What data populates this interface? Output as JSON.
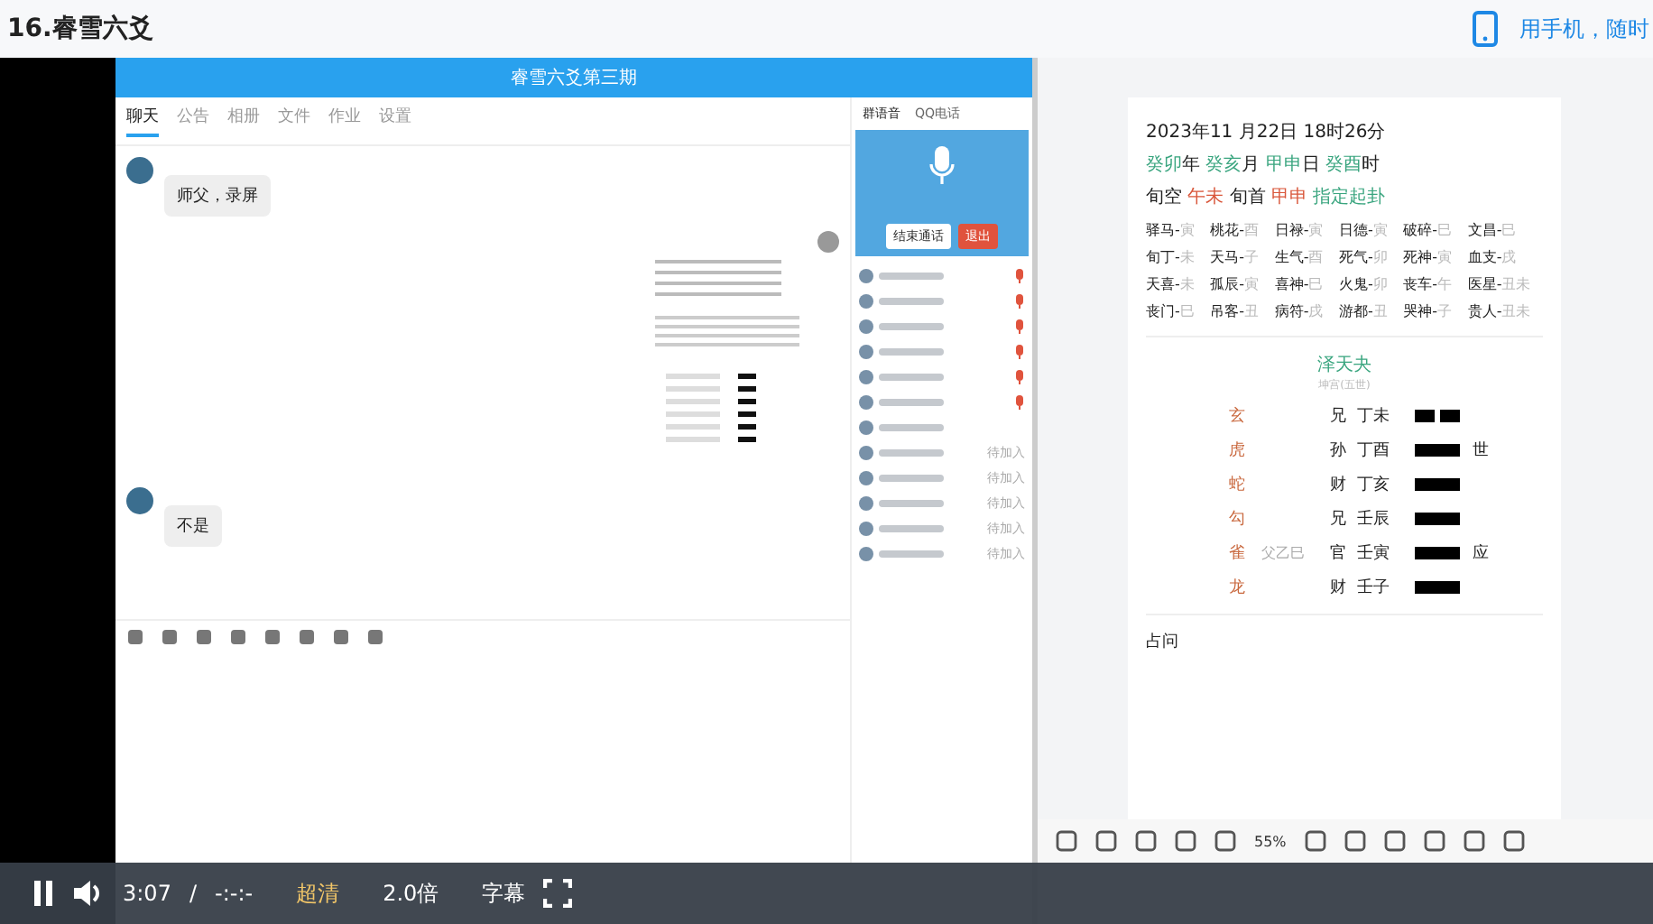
{
  "page": {
    "title": "16.睿雪六爻",
    "mobile_link": "用手机，随时"
  },
  "chat_window": {
    "title": "睿雪六爻第三期",
    "tabs": [
      {
        "label": "聊天",
        "selected": true
      },
      {
        "label": "公告",
        "selected": false
      },
      {
        "label": "相册",
        "selected": false
      },
      {
        "label": "文件",
        "selected": false
      },
      {
        "label": "作业",
        "selected": false
      },
      {
        "label": "设置",
        "selected": false
      }
    ],
    "messages": [
      {
        "kind": "text",
        "text": "师父，录屏"
      },
      {
        "kind": "image"
      },
      {
        "kind": "text",
        "text": "不是"
      }
    ],
    "voice_panel": {
      "tabs": [
        {
          "label": "群语音",
          "selected": true
        },
        {
          "label": "QQ电话",
          "selected": false
        }
      ],
      "end_button": "结束通话",
      "exit_button": "退出",
      "members": [
        {
          "kind": "muted"
        },
        {
          "kind": "muted"
        },
        {
          "kind": "muted"
        },
        {
          "kind": "muted"
        },
        {
          "kind": "muted"
        },
        {
          "kind": "muted"
        },
        {
          "kind": "idle"
        },
        {
          "kind": "pending",
          "label": "待加入"
        },
        {
          "kind": "pending",
          "label": "待加入"
        },
        {
          "kind": "pending",
          "label": "待加入"
        },
        {
          "kind": "pending",
          "label": "待加入"
        },
        {
          "kind": "pending",
          "label": "待加入"
        }
      ]
    }
  },
  "divination": {
    "date": "2023年11 月22日 18时26分",
    "ganzhi": [
      {
        "text": "癸卯",
        "color": "#3aa57f"
      },
      {
        "text": "年 ",
        "color": "#222222"
      },
      {
        "text": "癸亥",
        "color": "#3aa57f"
      },
      {
        "text": "月 ",
        "color": "#222222"
      },
      {
        "text": "甲申",
        "color": "#3aa57f"
      },
      {
        "text": "日 ",
        "color": "#222222"
      },
      {
        "text": "癸酉",
        "color": "#3aa57f"
      },
      {
        "text": "时",
        "color": "#222222"
      }
    ],
    "void": [
      {
        "text": "旬空 ",
        "color": "#222222"
      },
      {
        "text": "午未",
        "color": "#d9573b"
      },
      {
        "text": " 旬首 ",
        "color": "#222222"
      },
      {
        "text": "甲申",
        "color": "#d9573b"
      },
      {
        "text": " 指定起卦",
        "color": "#3aa57f"
      }
    ],
    "shensha": [
      {
        "label": "驿马-",
        "value": "寅"
      },
      {
        "label": "桃花-",
        "value": "酉"
      },
      {
        "label": "日禄-",
        "value": "寅"
      },
      {
        "label": "日德-",
        "value": "寅"
      },
      {
        "label": "破碎-",
        "value": "巳"
      },
      {
        "label": "文昌-",
        "value": "巳"
      },
      {
        "label": "旬丁-",
        "value": "未"
      },
      {
        "label": "天马-",
        "value": "子"
      },
      {
        "label": "生气-",
        "value": "酉"
      },
      {
        "label": "死气-",
        "value": "卯"
      },
      {
        "label": "死神-",
        "value": "寅"
      },
      {
        "label": "血支-",
        "value": "戌"
      },
      {
        "label": "天喜-",
        "value": "未"
      },
      {
        "label": "孤辰-",
        "value": "寅"
      },
      {
        "label": "喜神-",
        "value": "巳"
      },
      {
        "label": "火鬼-",
        "value": "卯"
      },
      {
        "label": "丧车-",
        "value": "午"
      },
      {
        "label": "医星-",
        "value": "丑未"
      },
      {
        "label": "丧门-",
        "value": "巳"
      },
      {
        "label": "吊客-",
        "value": "丑"
      },
      {
        "label": "病符-",
        "value": "戌"
      },
      {
        "label": "游都-",
        "value": "丑"
      },
      {
        "label": "哭神-",
        "value": "子"
      },
      {
        "label": "贵人-",
        "value": "丑未"
      }
    ],
    "hexagram": {
      "name": "泽天夬",
      "palace": "坤宫(五世)"
    },
    "lines": [
      {
        "god": "玄",
        "relative": "兄",
        "branch": "丁未",
        "kind": "yin"
      },
      {
        "god": "虎",
        "relative": "孙",
        "branch": "丁酉",
        "kind": "yang",
        "mark": "世"
      },
      {
        "god": "蛇",
        "relative": "财",
        "branch": "丁亥",
        "kind": "yang"
      },
      {
        "god": "勾",
        "relative": "兄",
        "branch": "壬辰",
        "kind": "yang"
      },
      {
        "god": "雀",
        "hidden": "父乙巳",
        "relative": "官",
        "branch": "壬寅",
        "kind": "yang",
        "mark": "应"
      },
      {
        "god": "龙",
        "relative": "财",
        "branch": "壬子",
        "kind": "yang"
      }
    ],
    "question_label": "占问",
    "zoom": "55%"
  },
  "player": {
    "playing": true,
    "time": "3:07",
    "separator": "/",
    "duration": "-:-:-",
    "quality": "超清",
    "speed": "2.0倍",
    "subtitles": "字幕"
  }
}
